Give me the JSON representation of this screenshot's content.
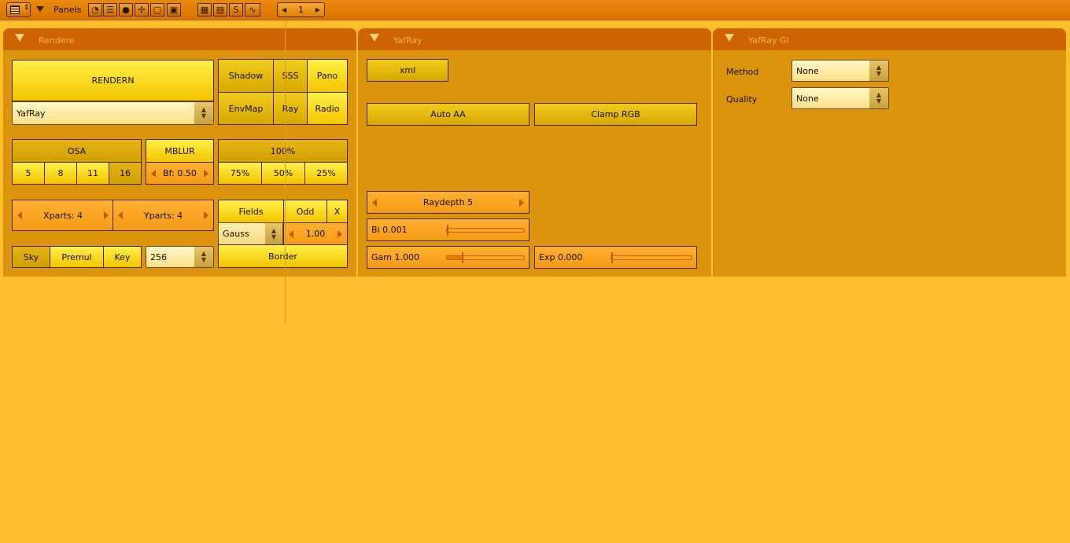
{
  "header": {
    "panels_label": "Panels",
    "frame_value": "1",
    "editor_icons": [
      "logic-icon",
      "script-icon",
      "shading-icon",
      "object-icon",
      "editing-icon",
      "scene-icon"
    ],
    "context_icons": [
      "render-icon",
      "anim-icon",
      "sound-icon",
      "world-icon"
    ]
  },
  "panels": {
    "render": {
      "title": "Rendere",
      "render_button": "RENDERN",
      "renderer_select": "YafRay",
      "toggles": {
        "shadow": "Shadow",
        "sss": "SSS",
        "pano": "Pano",
        "envmap": "EnvMap",
        "ray": "Ray",
        "radio": "Radio"
      },
      "osa": {
        "label": "OSA",
        "options": [
          "5",
          "8",
          "11",
          "16"
        ],
        "selected": "16"
      },
      "mblur": {
        "label": "MBLUR",
        "bf": "Bf: 0.50"
      },
      "size": {
        "label": "100%",
        "options": [
          "75%",
          "50%",
          "25%"
        ]
      },
      "xparts": "Xparts: 4",
      "yparts": "Yparts: 4",
      "fields": {
        "fields": "Fields",
        "odd": "Odd",
        "x": "X"
      },
      "filter": {
        "type": "Gauss",
        "value": "1.00"
      },
      "border": "Border",
      "alpha": {
        "sky": "Sky",
        "premul": "Premul",
        "key": "Key"
      },
      "color_depth": "256"
    },
    "yafray": {
      "title": "YafRay",
      "xml": "xml",
      "auto_aa": "Auto AA",
      "clamp_rgb": "Clamp RGB",
      "raydepth": "Raydepth 5",
      "bi": {
        "label": "Bi 0.001",
        "fraction": 0.001
      },
      "gam": {
        "label": "Gam 1.000",
        "fraction": 0.2
      },
      "exp": {
        "label": "Exp 0.000",
        "fraction": 0.0
      }
    },
    "yafray_gi": {
      "title": "YafRay GI",
      "method": {
        "label": "Method",
        "value": "None"
      },
      "quality": {
        "label": "Quality",
        "value": "None"
      }
    }
  },
  "colors": {
    "background": "#ffbe2c",
    "header": "#dc7a00",
    "panel": "#dc940e",
    "panel_title": "#cd6400",
    "button": "#ffe23a"
  }
}
